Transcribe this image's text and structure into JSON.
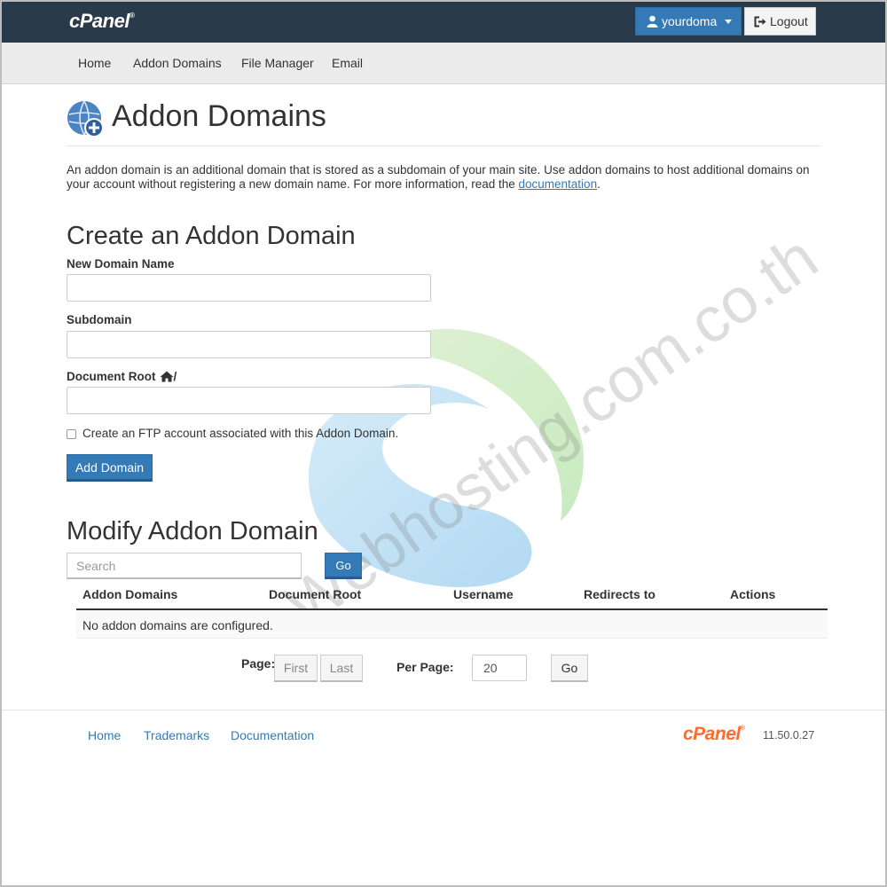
{
  "topbar": {
    "logo": "cPanel",
    "logo_mark": "®",
    "user_label": "yourdoma",
    "logout_label": "Logout"
  },
  "nav": {
    "items": [
      {
        "label": "Home"
      },
      {
        "label": "Addon Domains"
      },
      {
        "label": "File Manager"
      },
      {
        "label": "Email"
      }
    ]
  },
  "page": {
    "title": "Addon Domains",
    "intro_text": "An addon domain is an additional domain that is stored as a subdomain of your main site. Use addon domains to host additional domains on your account without registering a new domain name. For more information, read the ",
    "intro_link": "documentation",
    "intro_end": "."
  },
  "create": {
    "heading": "Create an Addon Domain",
    "new_domain_label": "New Domain Name",
    "new_domain_value": "",
    "subdomain_label": "Subdomain",
    "subdomain_value": "",
    "docroot_label": "Document Root",
    "docroot_suffix": "/",
    "docroot_value": "",
    "ftp_label": "Create an FTP account associated with this Addon Domain.",
    "ftp_checked": false,
    "submit_label": "Add Domain"
  },
  "modify": {
    "heading": "Modify Addon Domain",
    "search_placeholder": "Search",
    "go_label": "Go",
    "columns": [
      "Addon Domains",
      "Document Root",
      "Username",
      "Redirects to",
      "Actions"
    ],
    "empty_message": "No addon domains are configured.",
    "page_label": "Page:",
    "first_label": "First",
    "last_label": "Last",
    "per_page_label": "Per Page:",
    "per_page_value": "20",
    "go2_label": "Go"
  },
  "footer": {
    "links": [
      {
        "label": "Home"
      },
      {
        "label": "Trademarks"
      },
      {
        "label": "Documentation"
      }
    ],
    "logo": "cPanel",
    "logo_mark": "®",
    "version": "11.50.0.27"
  },
  "watermark": {
    "text": "Webhosting.com.co.th"
  },
  "colors": {
    "topbar": "#293a4a",
    "primary": "#337ab7",
    "link": "#337ab7",
    "footer_logo": "#ff6c2c"
  }
}
